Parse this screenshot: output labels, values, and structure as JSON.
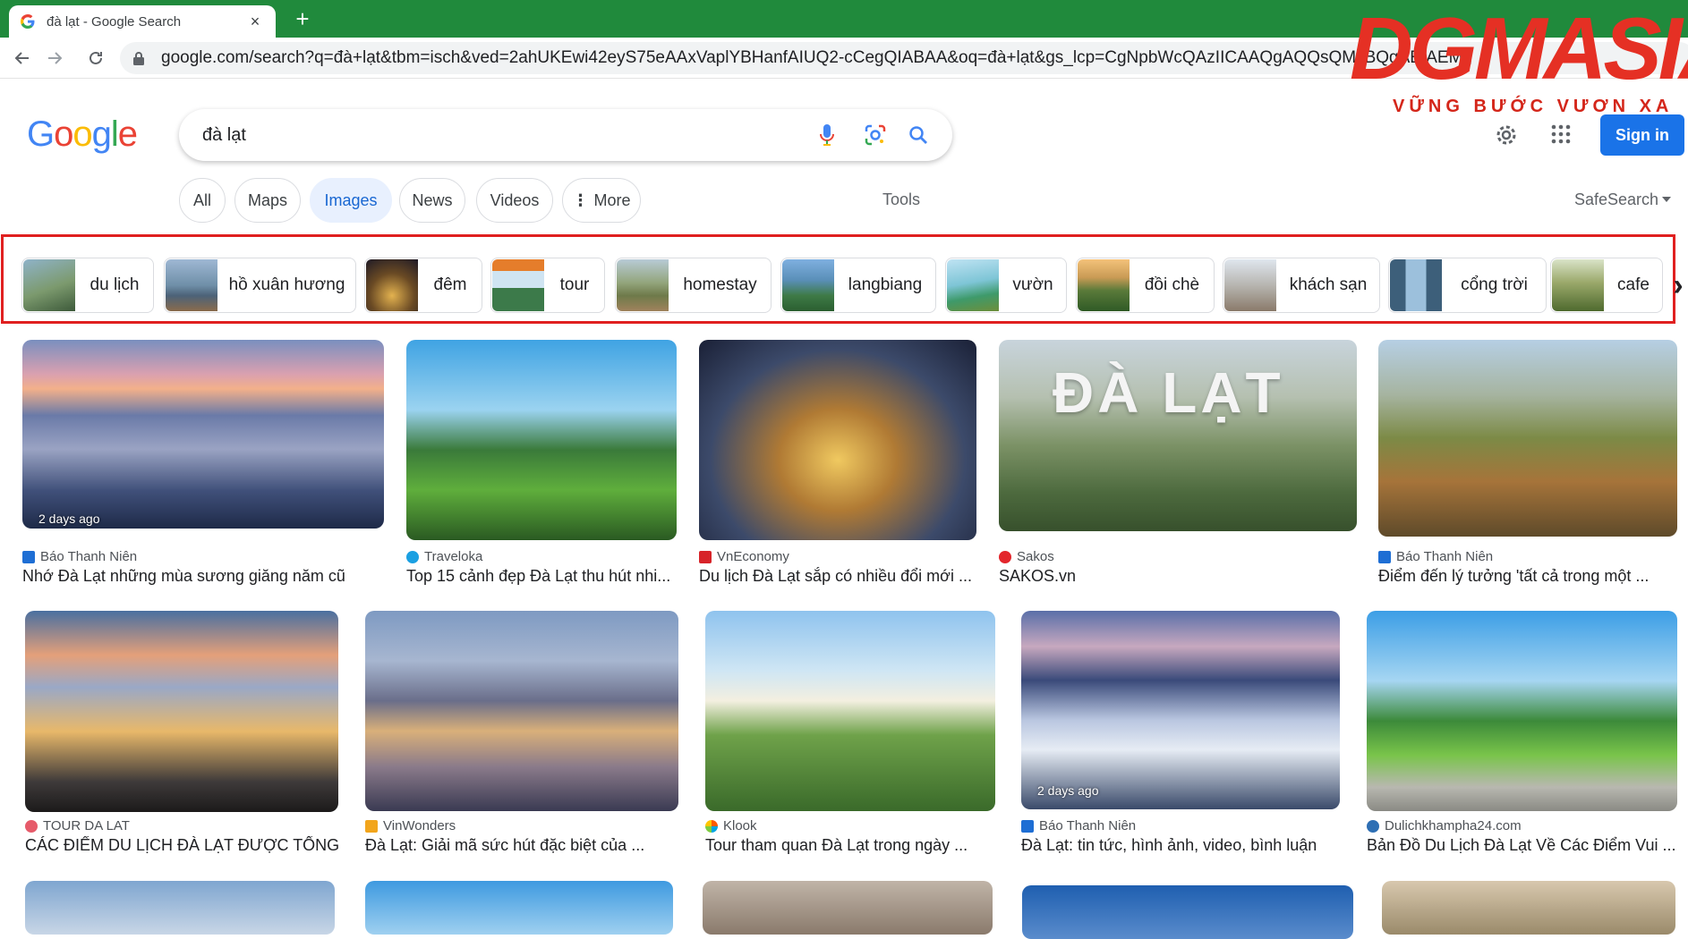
{
  "browser": {
    "tab_title": "đà lạt - Google Search",
    "tab_close": "×",
    "new_tab": "+",
    "url": "google.com/search?q=đà+lạt&tbm=isch&ved=2ahUKEwi42eyS75eAAxVaplYBHanfAIUQ2-cCegQIABAA&oq=đà+lạt&gs_lcp=CgNpbWcQAzIICAAQgAQQsQMyBQgAEIAEMg"
  },
  "watermark": {
    "brand": "DGMASIA",
    "slogan": "VỮNG BƯỚC VƯƠN XA",
    "color": "#e53024"
  },
  "header": {
    "logo_letters": [
      "G",
      "o",
      "o",
      "g",
      "l",
      "e"
    ],
    "search_value": "đà lạt",
    "signin_label": "Sign in"
  },
  "filters": {
    "chips": [
      "All",
      "Maps",
      "Images",
      "News",
      "Videos",
      "More"
    ],
    "active": "Images",
    "tools_label": "Tools",
    "safesearch_label": "SafeSearch"
  },
  "related": [
    "du lịch",
    "hồ xuân hương",
    "đêm",
    "tour",
    "homestay",
    "langbiang",
    "vườn",
    "đồi chè",
    "khách sạn",
    "cổng trời",
    "cafe"
  ],
  "results": [
    {
      "source": "Báo Thanh Niên",
      "title": "Nhớ Đà Lạt những mùa sương giăng năm cũ",
      "age": "2 days ago"
    },
    {
      "source": "Traveloka",
      "title": "Top 15 cảnh đẹp Đà Lạt thu hút nhi..."
    },
    {
      "source": "VnEconomy",
      "title": "Du lịch Đà Lạt sắp có nhiều đổi mới ..."
    },
    {
      "source": "Sakos",
      "title": "SAKOS.vn",
      "overlay": "ĐÀ LẠT"
    },
    {
      "source": "Báo Thanh Niên",
      "title": "Điểm đến lý tưởng 'tất cả trong một ..."
    },
    {
      "source": "TOUR DA LAT",
      "title": "CÁC ĐIỂM DU LỊCH ĐÀ LẠT ĐƯỢC TỔNG ..."
    },
    {
      "source": "VinWonders",
      "title": "Đà Lạt: Giải mã sức hút đặc biệt của ..."
    },
    {
      "source": "Klook",
      "title": "Tour tham quan Đà Lạt trong ngày ..."
    },
    {
      "source": "Báo Thanh Niên",
      "title": "Đà Lạt: tin tức, hình ảnh, video, bình luận",
      "age": "2 days ago"
    },
    {
      "source": "Dulichkhampha24.com",
      "title": "Bản Đồ Du Lịch Đà Lạt Về Các Điểm Vui ..."
    }
  ]
}
